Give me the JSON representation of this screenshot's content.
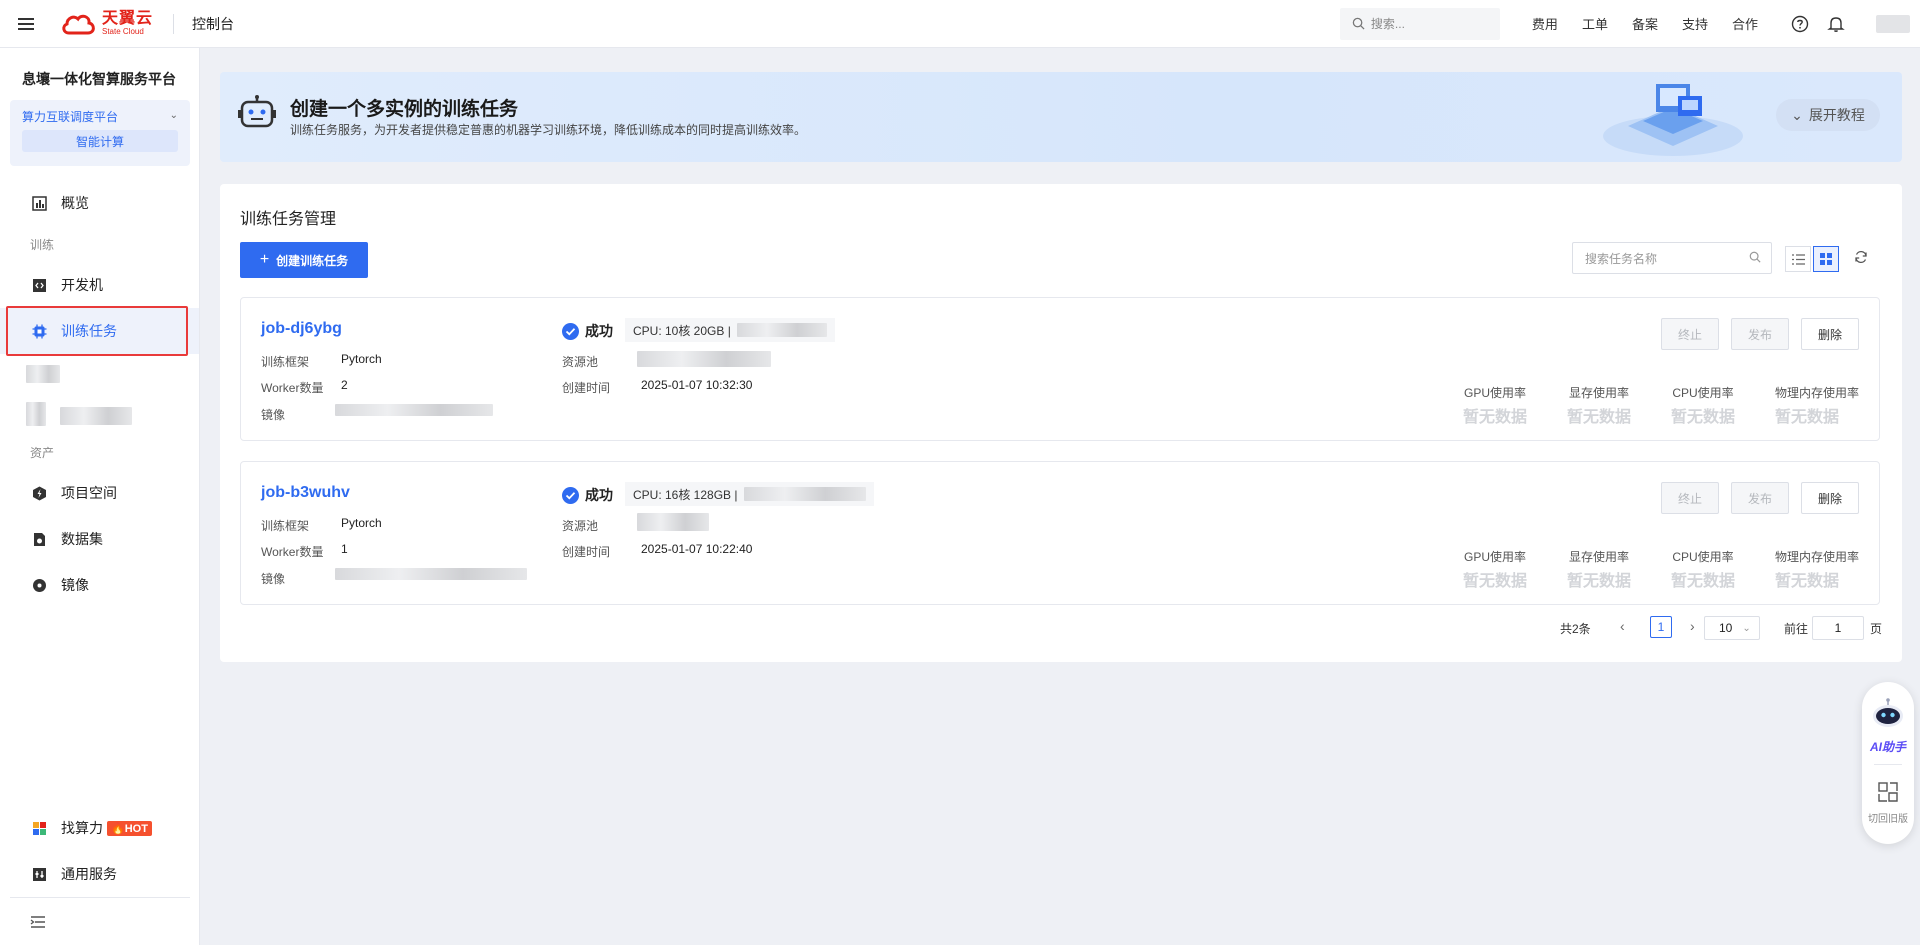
{
  "topbar": {
    "brand_cn": "天翼云",
    "brand_en": "State Cloud",
    "console": "控制台",
    "search_placeholder": "搜索...",
    "links": [
      "费用",
      "工单",
      "备案",
      "支持",
      "合作"
    ]
  },
  "sidebar": {
    "title": "息壤一体化智算服务平台",
    "platform_name": "算力互联调度平台",
    "platform_sub": "智能计算",
    "overview": "概览",
    "group_train": "训练",
    "dev_machine": "开发机",
    "train_task": "训练任务",
    "group_asset": "资产",
    "project_space": "项目空间",
    "dataset": "数据集",
    "image": "镜像",
    "find_compute": "找算力",
    "hot_badge": "HOT",
    "general_service": "通用服务"
  },
  "banner": {
    "title": "创建一个多实例的训练任务",
    "desc": "训练任务服务，为开发者提供稳定普惠的机器学习训练环境，降低训练成本的同时提高训练效率。",
    "expand": "展开教程"
  },
  "panel": {
    "title": "训练任务管理",
    "create_button": "创建训练任务",
    "search_placeholder": "搜索任务名称"
  },
  "labels": {
    "framework": "训练框架",
    "workers": "Worker数量",
    "image": "镜像",
    "pool": "资源池",
    "created": "创建时间",
    "stop": "终止",
    "publish": "发布",
    "delete": "删除",
    "gpu": "GPU使用率",
    "vram": "显存使用率",
    "cpu": "CPU使用率",
    "mem": "物理内存使用率",
    "no_data": "暂无数据"
  },
  "jobs": [
    {
      "name": "job-dj6ybg",
      "status": "成功",
      "spec": "CPU: 10核 20GB |",
      "framework": "Pytorch",
      "workers": "2",
      "created": "2025-01-07 10:32:30"
    },
    {
      "name": "job-b3wuhv",
      "status": "成功",
      "spec": "CPU: 16核 128GB |",
      "framework": "Pytorch",
      "workers": "1",
      "created": "2025-01-07 10:22:40"
    }
  ],
  "pagination": {
    "total": "共2条",
    "current": "1",
    "page_size": "10",
    "goto": "前往",
    "goto_value": "1",
    "page_label": "页"
  },
  "float": {
    "ai": "AI助手",
    "old": "切回旧版"
  }
}
